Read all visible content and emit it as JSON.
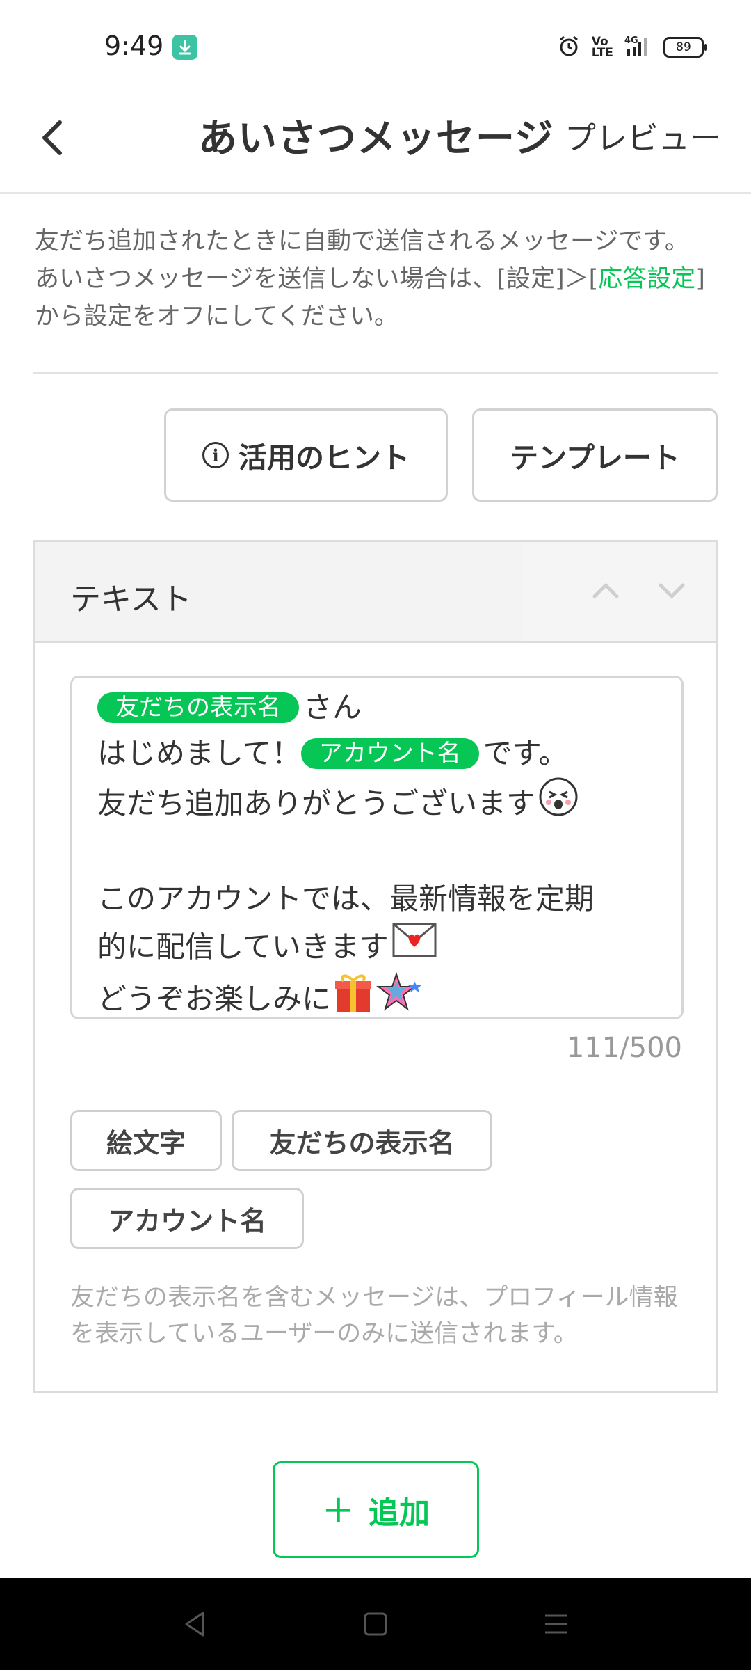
{
  "status_bar": {
    "time": "9:49",
    "battery": "89",
    "icons": [
      "download-icon",
      "alarm-icon",
      "volte-icon",
      "signal-4g-icon",
      "battery-icon"
    ]
  },
  "header": {
    "title": "あいさつメッセージ",
    "preview_label": "プレビュー"
  },
  "description": {
    "line1": "友だち追加されたときに自動で送信されるメッセージです。",
    "line2_before": "あいさつメッセージを送信しない場合は、[設定]＞[",
    "line2_link": "応答設定",
    "line2_after": "]",
    "line3": "から設定をオフにしてください。"
  },
  "actions": {
    "hint_label": "活用のヒント",
    "template_label": "テンプレート"
  },
  "card": {
    "title": "テキスト",
    "message": {
      "tag_friend_name": "友だちの表示名",
      "line1_suffix": "さん",
      "line2_prefix": "はじめまして！",
      "tag_account_name": "アカウント名",
      "line2_suffix": "です。",
      "line3": "友だち追加ありがとうございます",
      "line4": "このアカウントでは、最新情報を定期",
      "line5": "的に配信していきます",
      "line6": "どうぞお楽しみに"
    },
    "char_count": "111/500",
    "chips": {
      "emoji": "絵文字",
      "friend_name": "友だちの表示名",
      "account_name": "アカウント名"
    },
    "note": "友だちの表示名を含むメッセージは、プロフィール情報を表示しているユーザーのみに送信されます。"
  },
  "add_button_label": "追加",
  "colors": {
    "accent": "#06c755",
    "border": "#dcdcdc",
    "text": "#333333",
    "muted": "#999999"
  }
}
